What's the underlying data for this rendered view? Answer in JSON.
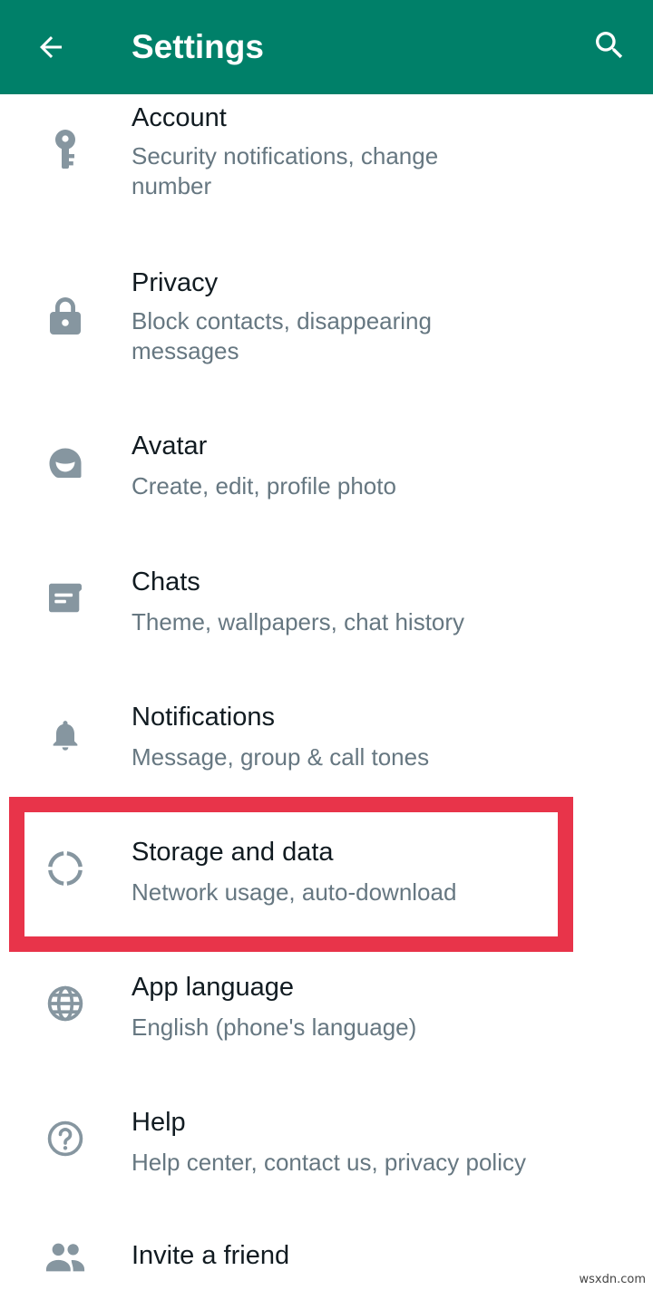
{
  "header": {
    "title": "Settings",
    "background": "#008069",
    "back_icon": "arrow-left-icon",
    "search_icon": "search-icon"
  },
  "items": [
    {
      "label": "Account",
      "desc": "Security notifications, change number",
      "icon": "key-icon"
    },
    {
      "label": "Privacy",
      "desc": "Block contacts, disappearing messages",
      "icon": "lock-icon"
    },
    {
      "label": "Avatar",
      "desc": "Create, edit, profile photo",
      "icon": "avatar-icon"
    },
    {
      "label": "Chats",
      "desc": "Theme, wallpapers, chat history",
      "icon": "chat-icon"
    },
    {
      "label": "Notifications",
      "desc": "Message, group & call tones",
      "icon": "bell-icon"
    },
    {
      "label": "Storage and data",
      "desc": "Network usage, auto-download",
      "icon": "storage-icon"
    },
    {
      "label": "App language",
      "desc": "English (phone's language)",
      "icon": "globe-icon"
    },
    {
      "label": "Help",
      "desc": "Help center, contact us, privacy policy",
      "icon": "help-icon"
    },
    {
      "label": "Invite a friend",
      "desc": "",
      "icon": "people-icon"
    }
  ],
  "highlight_color": "#e8344a",
  "watermark": "wsxdn.com"
}
